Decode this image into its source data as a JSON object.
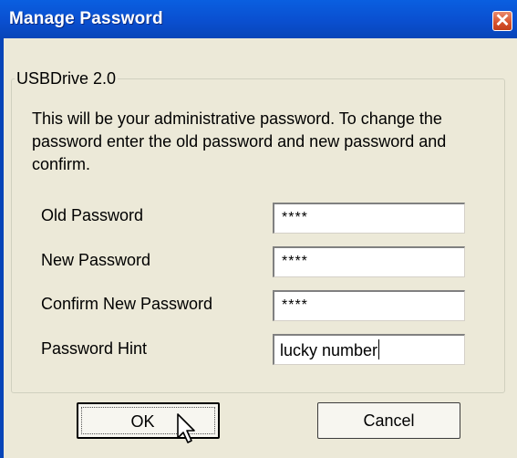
{
  "window": {
    "title": "Manage Password",
    "close_symbol": "✕"
  },
  "group": {
    "label": "USBDrive 2.0"
  },
  "description": "This will be your administrative password. To change the password enter  the old password and new password and confirm.",
  "fields": [
    {
      "label": "Old Password",
      "value": "****"
    },
    {
      "label": "New Password",
      "value": "****"
    },
    {
      "label": "Confirm New Password",
      "value": "****"
    },
    {
      "label": "Password Hint",
      "value": "lucky number"
    }
  ],
  "buttons": {
    "ok": "OK",
    "cancel": "Cancel"
  },
  "colors": {
    "titlebar": "#0a5fe0",
    "dialog_bg": "#ece9d8",
    "close_button": "#d6512b"
  },
  "icons": {
    "close": "close-icon",
    "pointer": "mouse-pointer-icon"
  }
}
